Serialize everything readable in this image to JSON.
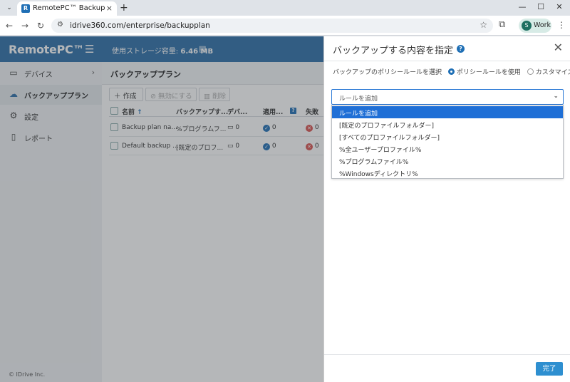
{
  "browser": {
    "tab_title": "RemotePC™ Backup",
    "tab_favicon": "R",
    "url": "idrive360.com/enterprise/backupplan",
    "profile_initial": "S",
    "profile_label": "Work"
  },
  "sidebar": {
    "logo": "RemotePC™",
    "items": [
      {
        "label": "デバイス",
        "icon": "devices-icon"
      },
      {
        "label": "バックアッププラン",
        "icon": "cloud-upload-icon"
      },
      {
        "label": "設定",
        "icon": "gear-icon"
      },
      {
        "label": "レポート",
        "icon": "report-icon"
      }
    ],
    "copyright": "© IDrive Inc."
  },
  "topbar": {
    "storage_label": "使用ストレージ容量: ",
    "storage_value": "6.46 MB"
  },
  "page": {
    "title": "バックアッププラン",
    "toolbar": {
      "create": "作成",
      "disable": "無効にする",
      "delete": "削除"
    },
    "columns": [
      "名前",
      "バックアップす...",
      "デバ...",
      "適用...",
      "失敗"
    ],
    "rows": [
      {
        "name": "Backup plan na...",
        "backup": "%プログラムフ...",
        "devices": "0",
        "applied": "0",
        "failed": "0"
      },
      {
        "name": "Default backup ...",
        "backup": "[既定のプロフ...",
        "devices": "0",
        "applied": "0",
        "failed": "0"
      }
    ]
  },
  "panel": {
    "title": "バックアップする内容を指定",
    "rule_label": "バックアップのポリシールールを選択",
    "option_policy": "ポリシールールを使用",
    "option_custom": "カスタマイズ",
    "select_value": "ルールを追加",
    "dropdown_options": [
      "ルールを追加",
      "[既定のプロファイルフォルダー]",
      "[すべてのプロファイルフォルダー]",
      "%全ユーザープロファイル%",
      "%プログラムファイル%",
      "%Windowsディレクトリ%"
    ],
    "done": "完了"
  }
}
